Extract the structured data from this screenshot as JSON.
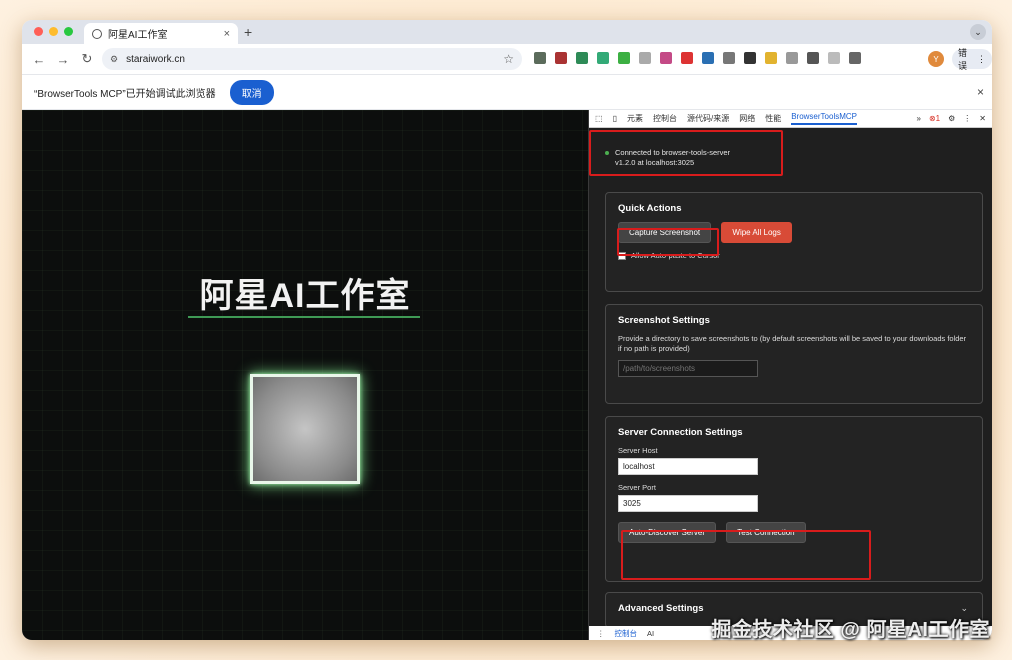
{
  "browser": {
    "tab_title": "阿星AI工作室",
    "tab_close": "×",
    "new_tab": "+",
    "url": "staraiwork.cn",
    "avatar_letter": "Y",
    "error_button_label": "错误"
  },
  "infobar": {
    "message": "“BrowserTools MCP”已开始调试此浏览器",
    "cancel_label": "取消",
    "close_glyph": "×"
  },
  "page": {
    "hero_title": "阿星AI工作室"
  },
  "devtools": {
    "tabs": [
      "元素",
      "控制台",
      "源代码/来源",
      "网络",
      "性能",
      "BrowserToolsMCP"
    ],
    "more": "»",
    "error_count": "1",
    "connection_line1": "Connected to browser-tools-server",
    "connection_line2": "v1.2.0 at localhost:3025",
    "quick_actions": {
      "title": "Quick Actions",
      "capture_label": "Capture Screenshot",
      "wipe_label": "Wipe All Logs",
      "auto_paste_label": "Allow Auto-paste to Cursor"
    },
    "screenshot_settings": {
      "title": "Screenshot Settings",
      "description": "Provide a directory to save screenshots to (by default screenshots will be saved to your downloads folder if no path is provided)",
      "path_placeholder": "/path/to/screenshots"
    },
    "server_settings": {
      "title": "Server Connection Settings",
      "host_label": "Server Host",
      "host_value": "localhost",
      "port_label": "Server Port",
      "port_value": "3025",
      "auto_discover_label": "Auto-Discover Server",
      "test_connection_label": "Test Connection"
    },
    "advanced_settings": {
      "title": "Advanced Settings"
    },
    "drawer_tabs": [
      "控制台",
      "AI"
    ]
  },
  "watermark": "掘金技术社区 @ 阿星AI工作室",
  "colors": {
    "accent_blue": "#1a5fd0",
    "highlight_red": "#d81c1c",
    "wipe_red": "#d84b37",
    "status_green": "#4caf50"
  }
}
